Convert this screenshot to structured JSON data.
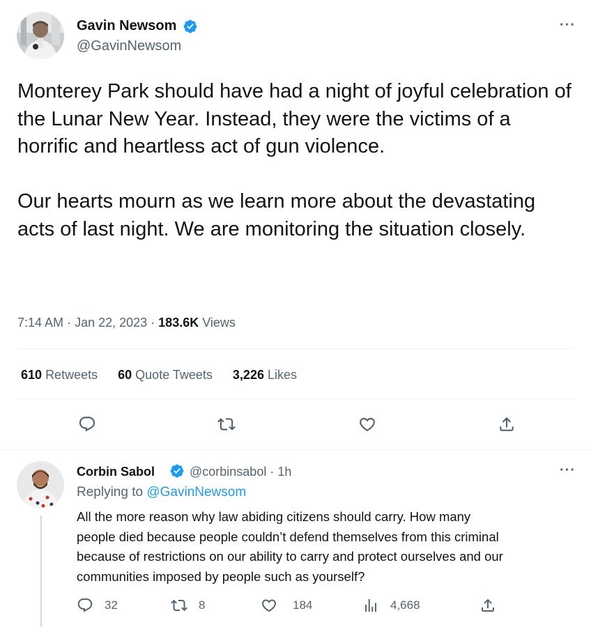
{
  "main_tweet": {
    "author_name": "Gavin Newsom",
    "author_handle": "@GavinNewsom",
    "more_label": "···",
    "text_paragraphs": [
      "Monterey Park should have had a night of joyful celebration of the Lunar New Year. Instead, they were the victims of a horrific and heartless act of gun violence.",
      "Our hearts mourn as we learn more about the devastating acts of last night. We are monitoring the situation closely."
    ],
    "time": "7:14 AM",
    "date": "Jan 22, 2023",
    "views_count": "183.6K",
    "views_label": "Views",
    "stats": {
      "retweets_count": "610",
      "retweets_label": "Retweets",
      "quotes_count": "60",
      "quotes_label": "Quote Tweets",
      "likes_count": "3,226",
      "likes_label": "Likes"
    },
    "actions": [
      "reply-icon",
      "retweet-icon",
      "like-icon",
      "share-icon"
    ]
  },
  "reply": {
    "author_name": "Corbin Sabol",
    "author_handle": "@corbinsabol",
    "time_ago": "1h",
    "more_label": "···",
    "replying_prefix": "Replying to",
    "replying_to": "@GavinNewsom",
    "text_lines": [
      "All the more reason why law abiding citizens should carry. How many",
      "people died because people couldn’t defend themselves from this criminal",
      "because of restrictions on our ability to carry and protect ourselves and our",
      "communities imposed by people such as yourself?"
    ],
    "actions": {
      "replies": "32",
      "retweets": "8",
      "likes": "184",
      "views": "4,668"
    }
  },
  "colors": {
    "accent": "#1d9bf0",
    "text_primary": "#0f1419",
    "text_secondary": "#536471",
    "divider": "#eff3f4"
  }
}
